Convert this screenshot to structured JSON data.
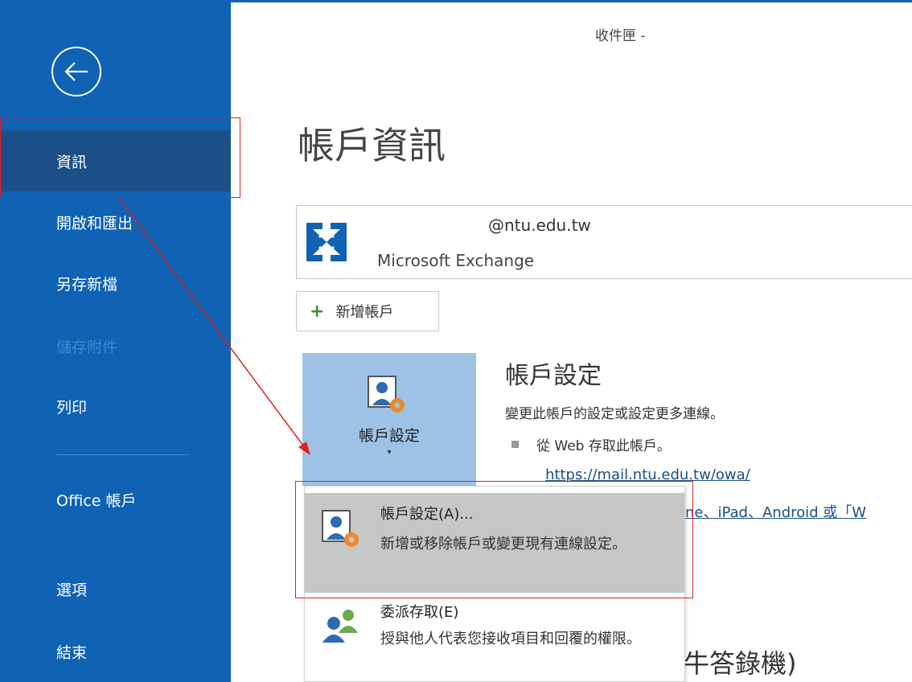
{
  "window": {
    "title": "收件匣 -"
  },
  "sidebar": {
    "back_icon": "arrow-left-circle-icon",
    "items": [
      {
        "label": "資訊",
        "active": true
      },
      {
        "label": "開啟和匯出"
      },
      {
        "label": "另存新檔"
      },
      {
        "label": "儲存附件",
        "disabled": true
      },
      {
        "label": "列印"
      },
      {
        "label": "Office 帳戶"
      },
      {
        "label": "選項"
      },
      {
        "label": "結束"
      }
    ]
  },
  "main": {
    "title": "帳戶資訊",
    "account": {
      "email": "@ntu.edu.tw",
      "type": "Microsoft Exchange",
      "icon": "exchange-icon"
    },
    "add_account_label": "新增帳戶",
    "account_settings": {
      "button_label": "帳戶設定",
      "caret": "▾",
      "section_title": "帳戶設定",
      "description": "變更此帳戶的設定或設定更多連線。",
      "web_access": "從 Web 存取此帳戶。",
      "owa_link": "https://mail.ntu.edu.tw/owa/",
      "partially_hidden_text": "ne、iPad、Android 或「W",
      "partially_hidden_heading": "牛答錄機)"
    },
    "dropdown": {
      "items": [
        {
          "title": "帳戶設定(A)...",
          "description": "新增或移除帳戶或變更現有連線設定。",
          "highlighted": true,
          "icon": "account-settings-icon"
        },
        {
          "title": "委派存取(E)",
          "description": "授與他人代表您接收項目和回覆的權限。",
          "icon": "delegate-access-icon"
        }
      ]
    }
  },
  "colors": {
    "sidebar": "#0f62b4",
    "active_item": "#1a4f87",
    "annotation": "#e02020"
  }
}
